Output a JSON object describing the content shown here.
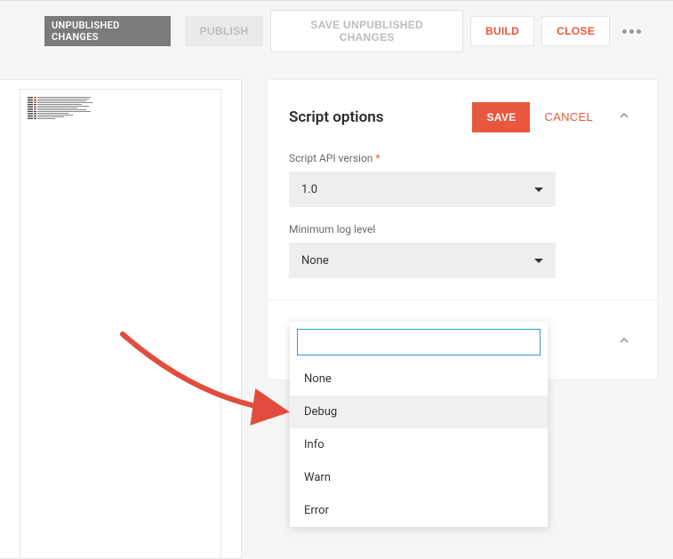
{
  "toolbar": {
    "badge": "UNPUBLISHED CHANGES",
    "publish": "PUBLISH",
    "save_unpublished": "SAVE UNPUBLISHED CHANGES",
    "build": "BUILD",
    "close": "CLOSE"
  },
  "panel": {
    "title": "Script options",
    "save": "SAVE",
    "cancel": "CANCEL",
    "api_version_label": "Script API version",
    "api_version_value": "1.0",
    "log_level_label": "Minimum log level",
    "log_level_value": "None"
  },
  "dropdown": {
    "options": [
      "None",
      "Debug",
      "Info",
      "Warn",
      "Error"
    ],
    "highlighted_index": 1
  },
  "annotation": {
    "arrow_color": "#e24c3f"
  }
}
